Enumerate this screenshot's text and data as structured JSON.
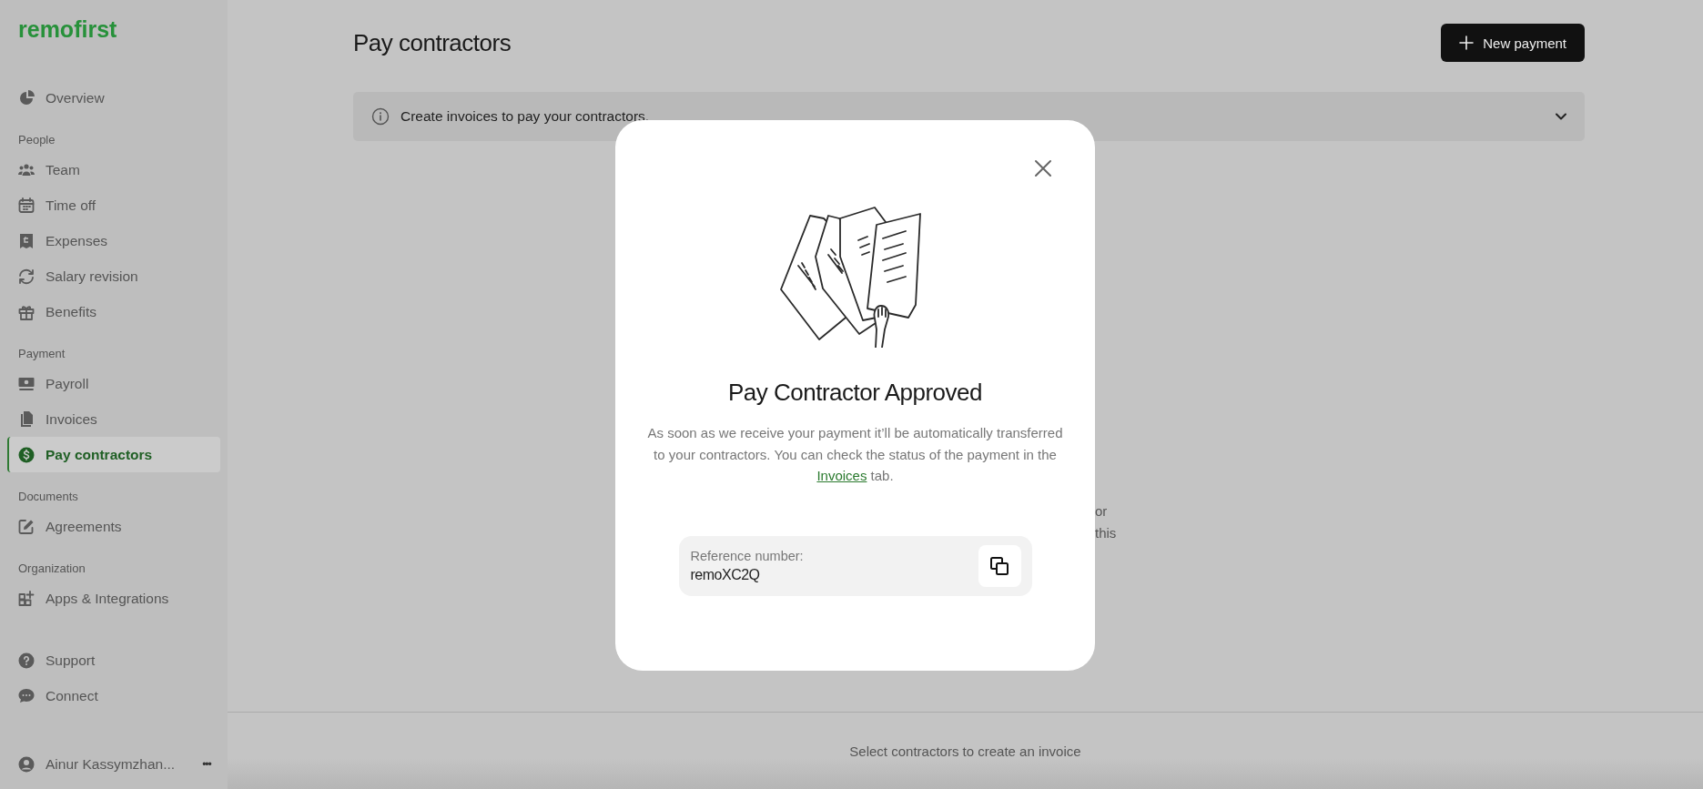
{
  "sidebar": {
    "logo": "remofirst",
    "sections": [
      {
        "items": [
          {
            "label": "Overview",
            "selected": false
          }
        ]
      },
      {
        "heading": "People",
        "items": [
          {
            "label": "Team",
            "selected": false
          },
          {
            "label": "Time off",
            "selected": false
          },
          {
            "label": "Expenses",
            "selected": false
          },
          {
            "label": "Salary revision",
            "selected": false
          },
          {
            "label": "Benefits",
            "selected": false
          }
        ]
      },
      {
        "heading": "Payment",
        "items": [
          {
            "label": "Payroll",
            "selected": false
          },
          {
            "label": "Invoices",
            "selected": false
          },
          {
            "label": "Pay contractors",
            "selected": true
          }
        ]
      },
      {
        "heading": "Documents",
        "items": [
          {
            "label": "Agreements",
            "selected": false
          }
        ]
      },
      {
        "heading": "Organization",
        "items": [
          {
            "label": "Apps & Integrations",
            "selected": false
          }
        ]
      },
      {
        "items": [
          {
            "label": "Support",
            "selected": false
          },
          {
            "label": "Connect",
            "selected": false
          }
        ]
      }
    ],
    "user": {
      "name": "Ainur Kassymzhan...",
      "menu": "•••"
    }
  },
  "page": {
    "title": "Pay contractors",
    "new_button": "New payment",
    "info_bar": "Create invoices to pay your contractors.",
    "background_fragments": [
      "or",
      "this"
    ],
    "footer": "Select contractors to create an invoice"
  },
  "modal": {
    "title": "Pay Contractor Approved",
    "message_before": "As soon as we receive your payment it’ll be automatically transferred to your contractors. You can check the status of the payment in the",
    "message_link": "Invoices",
    "message_after": "tab.",
    "reference_label": "Reference number:",
    "reference_value": "remoXC2Q"
  }
}
